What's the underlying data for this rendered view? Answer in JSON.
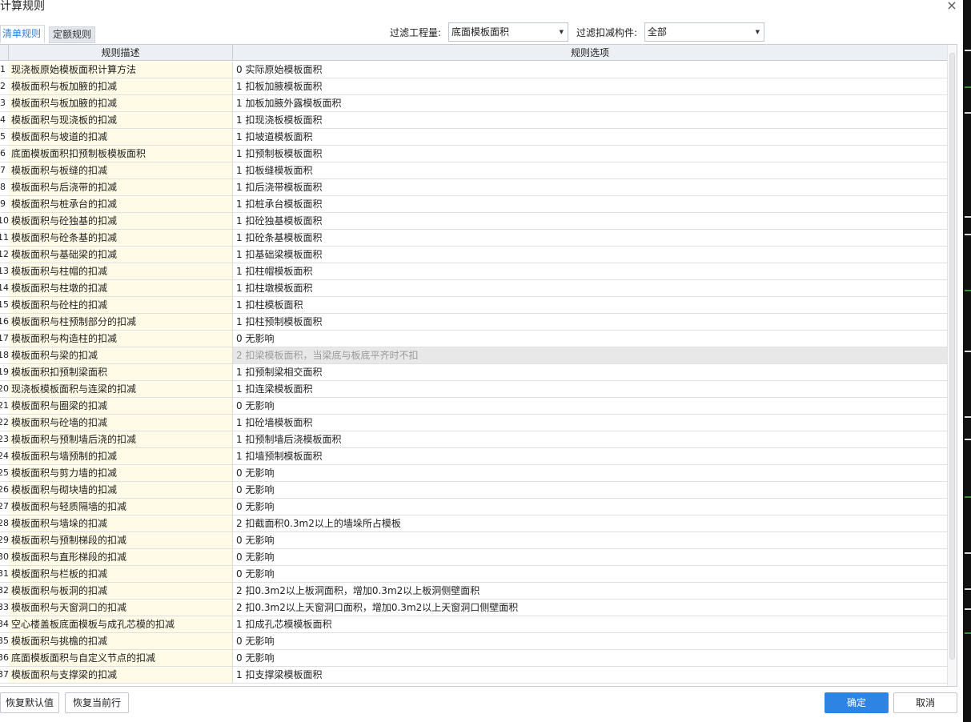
{
  "window": {
    "title": "计算规则"
  },
  "tabs": [
    {
      "label": "清单规则"
    },
    {
      "label": "定额规则"
    }
  ],
  "filters": {
    "quantity_label": "过滤工程量:",
    "quantity_value": "底面模板面积",
    "component_label": "过滤扣减构件:",
    "component_value": "全部"
  },
  "table": {
    "columns": [
      "规则描述",
      "规则选项"
    ],
    "selected_row": 18,
    "rows": [
      {
        "num": "1",
        "desc": "现浇板原始模板面积计算方法",
        "option": "0 实际原始模板面积"
      },
      {
        "num": "2",
        "desc": "模板面积与板加腋的扣减",
        "option": "1 扣板加腋模板面积"
      },
      {
        "num": "3",
        "desc": "模板面积与板加腋的扣减",
        "option": "1 加板加腋外露模板面积"
      },
      {
        "num": "4",
        "desc": "模板面积与现浇板的扣减",
        "option": "1 扣现浇板模板面积"
      },
      {
        "num": "5",
        "desc": "模板面积与坡道的扣减",
        "option": "1 扣坡道模板面积"
      },
      {
        "num": "6",
        "desc": "底面模板面积扣预制板模板面积",
        "option": "1 扣预制板模板面积"
      },
      {
        "num": "7",
        "desc": "模板面积与板缝的扣减",
        "option": "1  扣板缝模板面积"
      },
      {
        "num": "8",
        "desc": "模板面积与后浇带的扣减",
        "option": "1  扣后浇带模板面积"
      },
      {
        "num": "9",
        "desc": "模板面积与桩承台的扣减",
        "option": "1  扣桩承台模板面积"
      },
      {
        "num": "10",
        "desc": "模板面积与砼独基的扣减",
        "option": "1  扣砼独基模板面积"
      },
      {
        "num": "11",
        "desc": "模板面积与砼条基的扣减",
        "option": "1  扣砼条基模板面积"
      },
      {
        "num": "12",
        "desc": "模板面积与基础梁的扣减",
        "option": "1  扣基础梁模板面积"
      },
      {
        "num": "13",
        "desc": "模板面积与柱帽的扣减",
        "option": "1  扣柱帽模板面积"
      },
      {
        "num": "14",
        "desc": "模板面积与柱墩的扣减",
        "option": "1  扣柱墩模板面积"
      },
      {
        "num": "15",
        "desc": "模板面积与砼柱的扣减",
        "option": "1  扣柱模板面积"
      },
      {
        "num": "16",
        "desc": "模板面积与柱预制部分的扣减",
        "option": "1  扣柱预制模板面积"
      },
      {
        "num": "17",
        "desc": "模板面积与构造柱的扣减",
        "option": "0  无影响"
      },
      {
        "num": "18",
        "desc": "模板面积与梁的扣减",
        "option": "2  扣梁模板面积，当梁底与板底平齐时不扣"
      },
      {
        "num": "19",
        "desc": "模板面积扣预制梁面积",
        "option": "1  扣预制梁相交面积"
      },
      {
        "num": "20",
        "desc": "现浇板模板面积与连梁的扣减",
        "option": "1  扣连梁模板面积"
      },
      {
        "num": "21",
        "desc": "模板面积与圈梁的扣减",
        "option": "0  无影响"
      },
      {
        "num": "22",
        "desc": "模板面积与砼墙的扣减",
        "option": "1  扣砼墙模板面积"
      },
      {
        "num": "23",
        "desc": "模板面积与预制墙后浇的扣减",
        "option": "1  扣预制墙后浇模板面积"
      },
      {
        "num": "24",
        "desc": "模板面积与墙预制的扣减",
        "option": "1  扣墙预制模板面积"
      },
      {
        "num": "25",
        "desc": "模板面积与剪力墙的扣减",
        "option": "0  无影响"
      },
      {
        "num": "26",
        "desc": "模板面积与砌块墙的扣减",
        "option": "0  无影响"
      },
      {
        "num": "27",
        "desc": "模板面积与轻质隔墙的扣减",
        "option": "0  无影响"
      },
      {
        "num": "28",
        "desc": "模板面积与墙垛的扣减",
        "option": "2 扣截面积0.3m2以上的墙垛所占模板"
      },
      {
        "num": "29",
        "desc": "模板面积与预制梯段的扣减",
        "option": "0  无影响"
      },
      {
        "num": "30",
        "desc": "模板面积与直形梯段的扣减",
        "option": "0  无影响"
      },
      {
        "num": "31",
        "desc": "模板面积与栏板的扣减",
        "option": "0  无影响"
      },
      {
        "num": "32",
        "desc": "模板面积与板洞的扣减",
        "option": "2  扣0.3m2以上板洞面积，增加0.3m2以上板洞侧壁面积"
      },
      {
        "num": "33",
        "desc": "模板面积与天窗洞口的扣减",
        "option": "2  扣0.3m2以上天窗洞口面积，增加0.3m2以上天窗洞口侧壁面积"
      },
      {
        "num": "34",
        "desc": "空心楼盖板底面模板与成孔芯模的扣减",
        "option": "1 扣成孔芯模模板面积"
      },
      {
        "num": "35",
        "desc": "模板面积与挑檐的扣减",
        "option": "0  无影响"
      },
      {
        "num": "36",
        "desc": "底面模板面积与自定义节点的扣减",
        "option": "0  无影响"
      },
      {
        "num": "37",
        "desc": "模板面积与支撑梁的扣减",
        "option": "1  扣支撑梁模板面积"
      }
    ]
  },
  "buttons": {
    "restore_default": "恢复默认值",
    "restore_row": "恢复当前行",
    "ok": "确定",
    "cancel": "取消"
  },
  "icons": {
    "close": "close-icon",
    "dropdown": "dropdown-arrow-icon"
  },
  "colors": {
    "accent": "#2d84e2",
    "desc_column_bg": "#fffbe6",
    "selected_row_bg": "#e8e8e8"
  }
}
